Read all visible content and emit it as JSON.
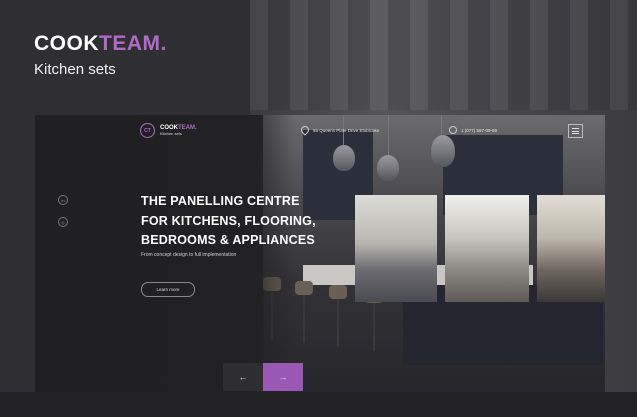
{
  "brand": {
    "word_main": "COOK",
    "word_accent": "TEAM.",
    "subtitle": "Kitchen sets"
  },
  "site": {
    "logo": {
      "mark": "CT",
      "word_main": "COOK",
      "word_accent": "TEAM.",
      "subtitle": "Kitchen sets"
    },
    "address": "55 Queens Plate Drive Etobicoke",
    "phone": "1 (077) 597-09-59",
    "hero": {
      "title_line1": "THE PANELLING CENTRE",
      "title_line2": "FOR KITCHENS, FLOORING,",
      "title_line3": "BEDROOMS & APPLIANCES",
      "subtitle": "From concept design to full implementation",
      "cta": "Learn more"
    },
    "nav": {
      "prev": "←",
      "next": "→"
    },
    "social": {
      "first": "in",
      "second": "◎"
    }
  },
  "colors": {
    "accent": "#b06bc7",
    "nav_next": "#9a58b4",
    "background": "#2b2b2e"
  },
  "icons": [
    "location-pin-icon",
    "phone-icon",
    "menu-icon",
    "social-icon",
    "arrow-left-icon",
    "arrow-right-icon"
  ]
}
